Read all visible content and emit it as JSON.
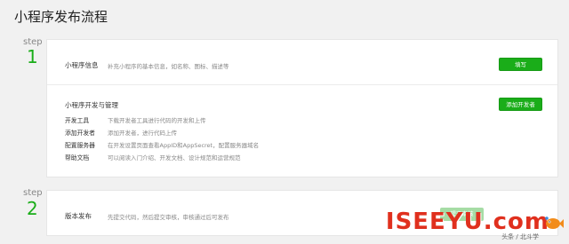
{
  "page": {
    "title": "小程序发布流程"
  },
  "steps": [
    {
      "label": "step",
      "number": "1"
    },
    {
      "label": "step",
      "number": "2"
    }
  ],
  "step1": {
    "info": {
      "title": "小程序信息",
      "desc": "补充小程序的基本信息，如名称、图标、描述等",
      "button": "填写"
    },
    "dev": {
      "title": "小程序开发与管理",
      "button": "添加开发者",
      "items": [
        {
          "label": "开发工具",
          "desc": "下载开发者工具进行代码的开发和上传"
        },
        {
          "label": "添加开发者",
          "desc": "添加开发者，进行代码上传"
        },
        {
          "label": "配置服务器",
          "desc": "在开发设置页面查看AppID和AppSecret，配置服务器域名"
        },
        {
          "label": "帮助文档",
          "desc": "可以阅读入门介绍、开发文档、设计规范和运营规范"
        }
      ]
    }
  },
  "step2": {
    "release": {
      "title": "版本发布",
      "desc": "先提交代码，然后提交审核，审核通过后可发布",
      "button": "提交审核"
    }
  },
  "watermark": {
    "brand": "ISEEYU.com",
    "sub": "头条 / 北斗学"
  },
  "colors": {
    "accent": "#1aad19",
    "watermark": "#e0301e"
  }
}
